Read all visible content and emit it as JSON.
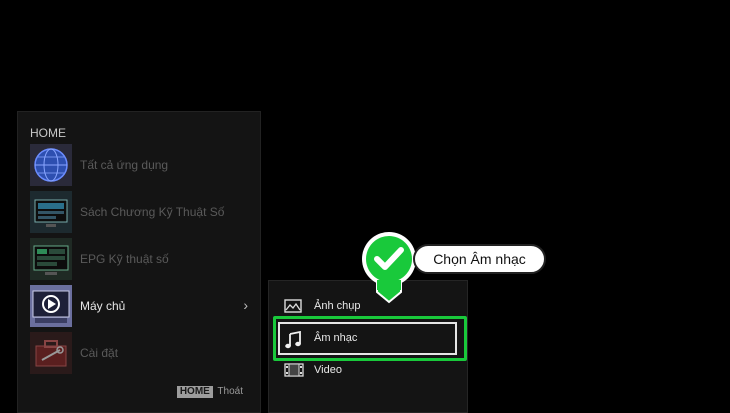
{
  "home_menu": {
    "title": "HOME",
    "items": [
      {
        "label": "Tất cả ứng dụng",
        "icon": "globe-icon"
      },
      {
        "label": "Sách Chương Kỹ Thuật Số",
        "icon": "digital-book-icon"
      },
      {
        "label": "EPG Kỹ thuật số",
        "icon": "epg-icon"
      },
      {
        "label": "Máy chủ",
        "icon": "media-server-icon",
        "selected": true
      },
      {
        "label": "Cài đặt",
        "icon": "settings-toolbox-icon"
      }
    ],
    "footer_key": "HOME",
    "footer_text": "Thoát"
  },
  "submenu": {
    "items": [
      {
        "label": "Ảnh chụp",
        "icon": "photo-icon"
      },
      {
        "label": "Âm nhạc",
        "icon": "music-note-icon",
        "selected": true
      },
      {
        "label": "Video",
        "icon": "film-strip-icon"
      }
    ]
  },
  "annotation": {
    "callout_text": "Chọn Âm nhạc",
    "accent_color": "#19c93b"
  }
}
